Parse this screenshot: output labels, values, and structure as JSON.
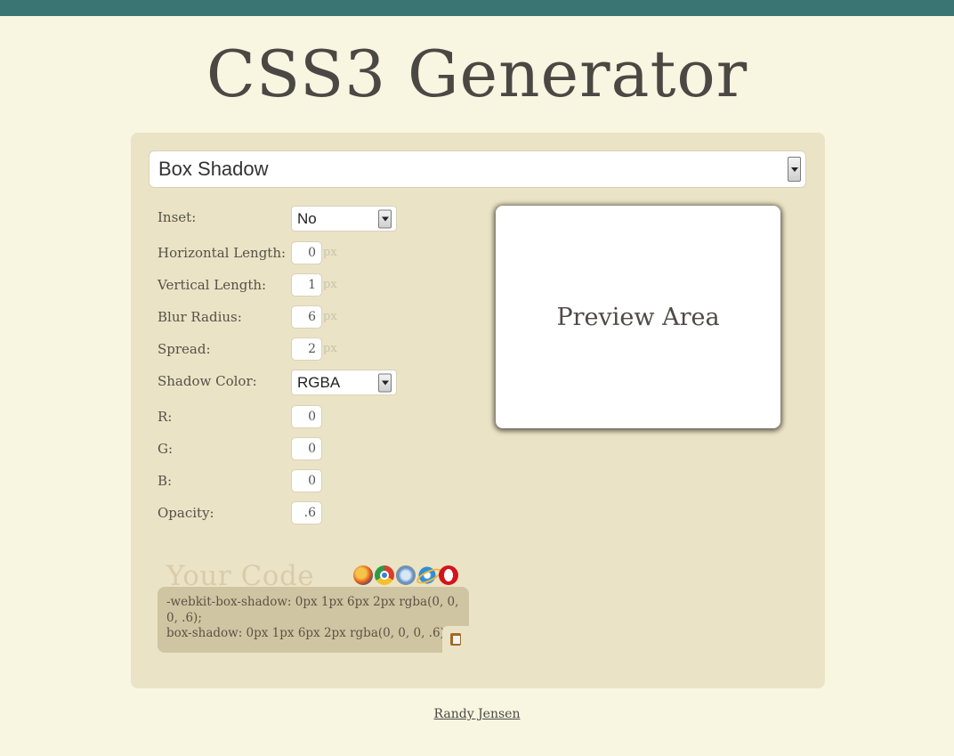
{
  "header": {
    "title": "CSS3 Generator"
  },
  "generator": {
    "selected_type": "Box Shadow"
  },
  "form": {
    "inset": {
      "label": "Inset:",
      "value": "No"
    },
    "horizontal": {
      "label": "Horizontal Length:",
      "value": "0",
      "unit": "px"
    },
    "vertical": {
      "label": "Vertical Length:",
      "value": "1",
      "unit": "px"
    },
    "blur": {
      "label": "Blur Radius:",
      "value": "6",
      "unit": "px"
    },
    "spread": {
      "label": "Spread:",
      "value": "2",
      "unit": "px"
    },
    "color_mode": {
      "label": "Shadow Color:",
      "value": "RGBA"
    },
    "r": {
      "label": "R:",
      "value": "0"
    },
    "g": {
      "label": "G:",
      "value": "0"
    },
    "b": {
      "label": "B:",
      "value": "0"
    },
    "opacity": {
      "label": "Opacity:",
      "value": ".6"
    }
  },
  "preview": {
    "text": "Preview Area"
  },
  "code": {
    "title": "Your Code",
    "browsers": [
      "firefox-icon",
      "chrome-icon",
      "safari-icon",
      "ie-icon",
      "opera-icon"
    ],
    "line1": "-webkit-box-shadow: 0px 1px 6px 2px rgba(0, 0, 0, .6);",
    "line2": "box-shadow: 0px 1px 6px 2px rgba(0, 0, 0, .6);"
  },
  "footer": {
    "author": "Randy Jensen"
  },
  "colors": {
    "topbar": "#3a7574",
    "background": "#f8f5e1",
    "panel": "#ebe3c5",
    "codebox": "#cfc5a2"
  }
}
